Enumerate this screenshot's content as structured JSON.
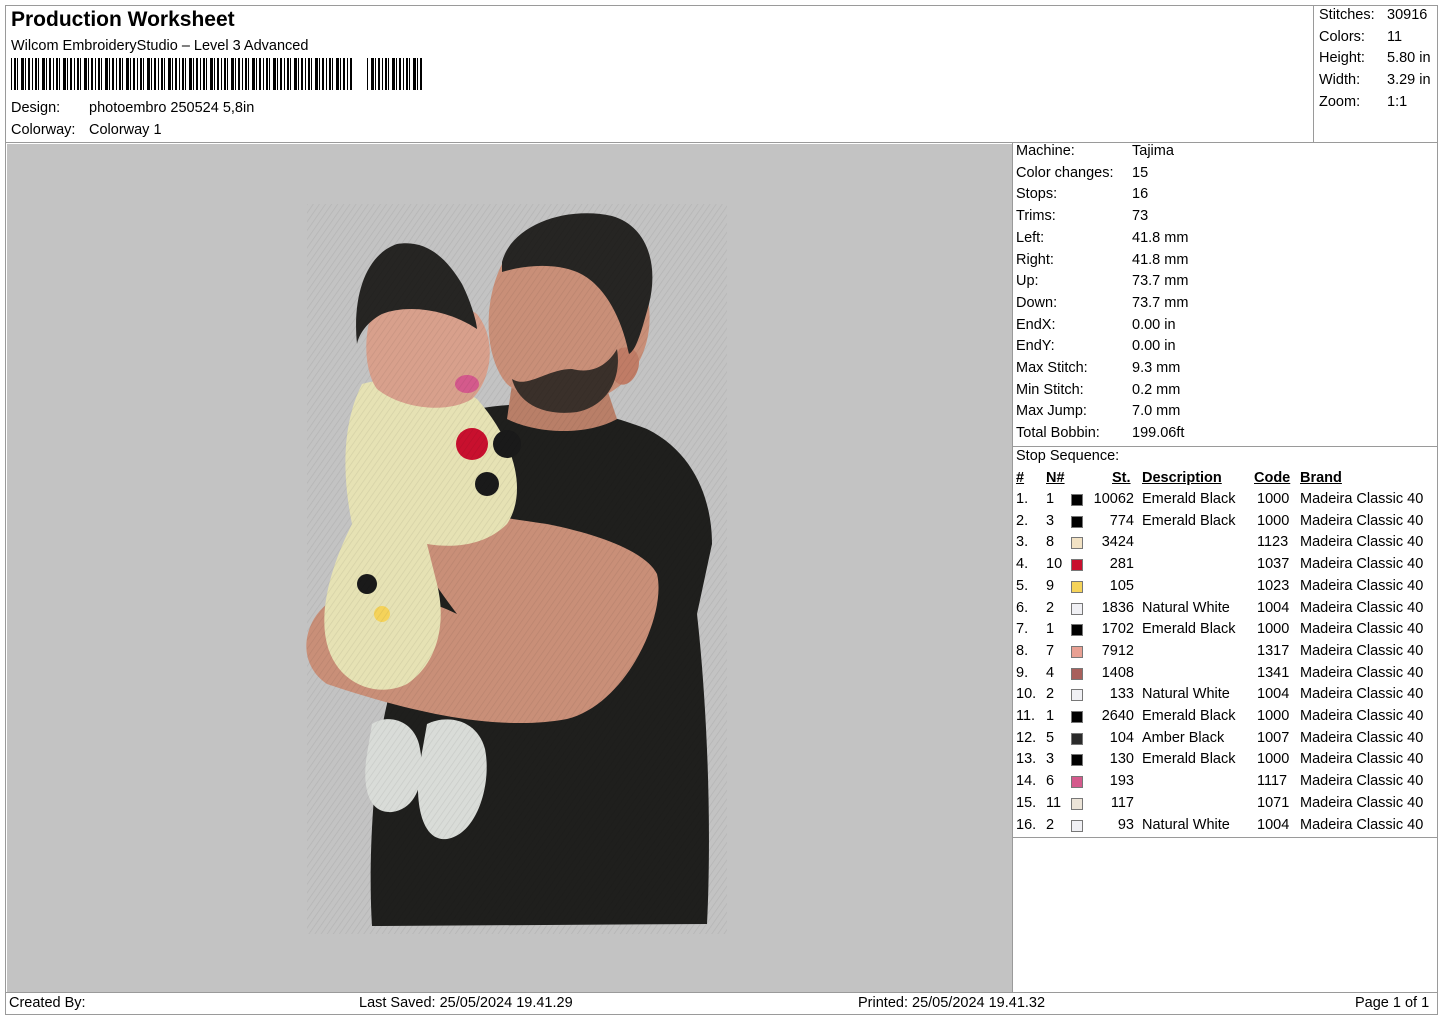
{
  "header": {
    "title": "Production Worksheet",
    "subtitle": "Wilcom EmbroideryStudio – Level 3 Advanced",
    "design_label": "Design:",
    "design_value": "photoembro 250524 5,8in",
    "colorway_label": "Colorway:",
    "colorway_value": "Colorway 1"
  },
  "summary": [
    {
      "label": "Stitches:",
      "value": "30916"
    },
    {
      "label": "Colors:",
      "value": "11"
    },
    {
      "label": "Height:",
      "value": "5.80 in"
    },
    {
      "label": "Width:",
      "value": "3.29 in"
    },
    {
      "label": "Zoom:",
      "value": "1:1"
    }
  ],
  "machine_info": [
    {
      "label": "Machine:",
      "value": "Tajima"
    },
    {
      "label": "Color changes:",
      "value": "15"
    },
    {
      "label": "Stops:",
      "value": "16"
    },
    {
      "label": "Trims:",
      "value": "73"
    },
    {
      "label": "Left:",
      "value": "41.8 mm"
    },
    {
      "label": "Right:",
      "value": "41.8 mm"
    },
    {
      "label": "Up:",
      "value": "73.7 mm"
    },
    {
      "label": "Down:",
      "value": "73.7 mm"
    },
    {
      "label": "EndX:",
      "value": "0.00 in"
    },
    {
      "label": "EndY:",
      "value": "0.00 in"
    },
    {
      "label": "Max Stitch:",
      "value": "9.3 mm"
    },
    {
      "label": "Min Stitch:",
      "value": "0.2 mm"
    },
    {
      "label": "Max Jump:",
      "value": "7.0 mm"
    },
    {
      "label": "Total Bobbin:",
      "value": "199.06ft"
    }
  ],
  "stop_sequence": {
    "title": "Stop Sequence:",
    "headers": {
      "num": "#",
      "n": "N#",
      "st": "St.",
      "desc": "Description",
      "code": "Code",
      "brand": "Brand"
    },
    "rows": [
      {
        "num": "1.",
        "n": "1",
        "color": "#000000",
        "st": "10062",
        "desc": "Emerald Black",
        "code": "1000",
        "brand": "Madeira Classic 40"
      },
      {
        "num": "2.",
        "n": "3",
        "color": "#000000",
        "st": "774",
        "desc": "Emerald Black",
        "code": "1000",
        "brand": "Madeira Classic 40"
      },
      {
        "num": "3.",
        "n": "8",
        "color": "#f2e2c4",
        "st": "3424",
        "desc": "",
        "code": "1123",
        "brand": "Madeira Classic 40"
      },
      {
        "num": "4.",
        "n": "10",
        "color": "#c8102e",
        "st": "281",
        "desc": "",
        "code": "1037",
        "brand": "Madeira Classic 40"
      },
      {
        "num": "5.",
        "n": "9",
        "color": "#f5d35a",
        "st": "105",
        "desc": "",
        "code": "1023",
        "brand": "Madeira Classic 40"
      },
      {
        "num": "6.",
        "n": "2",
        "color": "#f0f0f4",
        "st": "1836",
        "desc": "Natural White",
        "code": "1004",
        "brand": "Madeira Classic 40"
      },
      {
        "num": "7.",
        "n": "1",
        "color": "#000000",
        "st": "1702",
        "desc": "Emerald Black",
        "code": "1000",
        "brand": "Madeira Classic 40"
      },
      {
        "num": "8.",
        "n": "7",
        "color": "#e8a093",
        "st": "7912",
        "desc": "",
        "code": "1317",
        "brand": "Madeira Classic 40"
      },
      {
        "num": "9.",
        "n": "4",
        "color": "#a8605c",
        "st": "1408",
        "desc": "",
        "code": "1341",
        "brand": "Madeira Classic 40"
      },
      {
        "num": "10.",
        "n": "2",
        "color": "#f0f0f4",
        "st": "133",
        "desc": "Natural White",
        "code": "1004",
        "brand": "Madeira Classic 40"
      },
      {
        "num": "11.",
        "n": "1",
        "color": "#000000",
        "st": "2640",
        "desc": "Emerald Black",
        "code": "1000",
        "brand": "Madeira Classic 40"
      },
      {
        "num": "12.",
        "n": "5",
        "color": "#2a2a2a",
        "st": "104",
        "desc": "Amber Black",
        "code": "1007",
        "brand": "Madeira Classic 40"
      },
      {
        "num": "13.",
        "n": "3",
        "color": "#000000",
        "st": "130",
        "desc": "Emerald Black",
        "code": "1000",
        "brand": "Madeira Classic 40"
      },
      {
        "num": "14.",
        "n": "6",
        "color": "#d45a8c",
        "st": "193",
        "desc": "",
        "code": "1117",
        "brand": "Madeira Classic 40"
      },
      {
        "num": "15.",
        "n": "11",
        "color": "#ece4d8",
        "st": "117",
        "desc": "",
        "code": "1071",
        "brand": "Madeira Classic 40"
      },
      {
        "num": "16.",
        "n": "2",
        "color": "#f0f0f4",
        "st": "93",
        "desc": "Natural White",
        "code": "1004",
        "brand": "Madeira Classic 40"
      }
    ]
  },
  "footer": {
    "created_by": "Created By:",
    "last_saved": "Last Saved: 25/05/2024 19.41.29",
    "printed": "Printed: 25/05/2024 19.41.32",
    "page": "Page 1 of 1"
  },
  "colors": {
    "canvas": "#c3c3c3",
    "skin": "#c98f78",
    "shirt": "#1f1f1d",
    "hair": "#262523",
    "onesie": "#e6e2b4",
    "sock": "#d9dcd8",
    "mouse_red": "#c8102e"
  }
}
